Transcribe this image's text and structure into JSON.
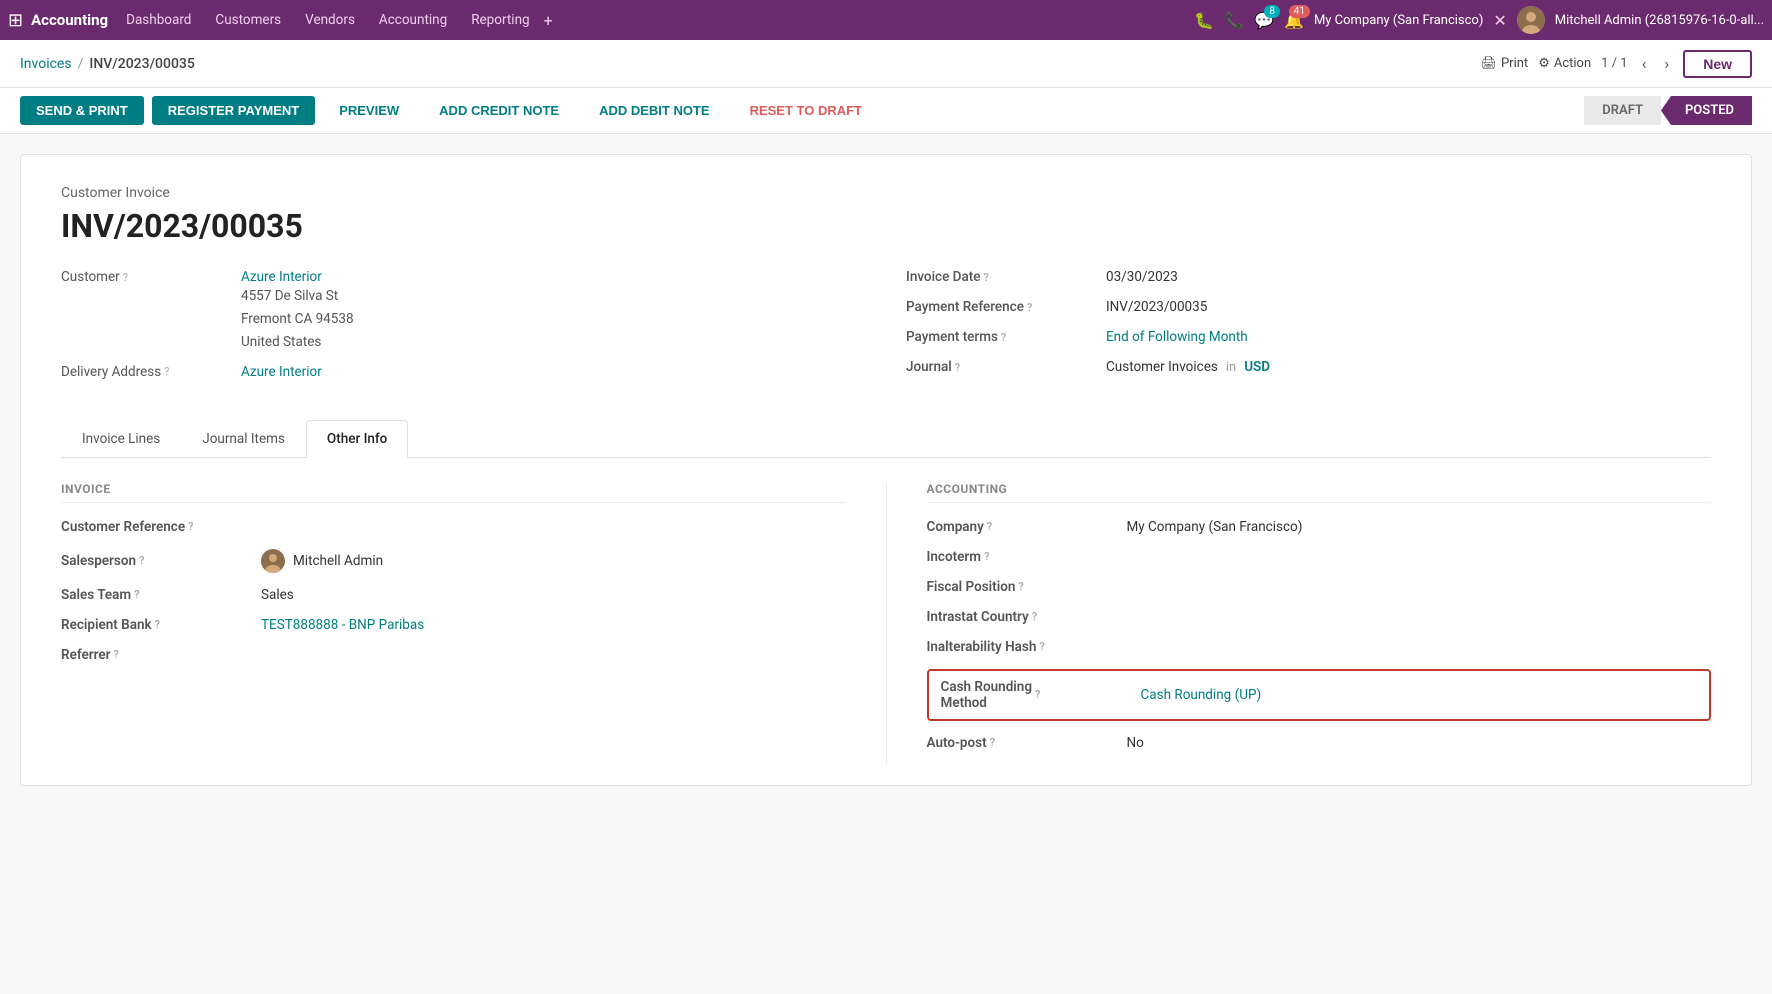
{
  "topnav": {
    "app_icon": "⊞",
    "brand": "Accounting",
    "links": [
      "Dashboard",
      "Customers",
      "Vendors",
      "Accounting",
      "Reporting"
    ],
    "plus": "+",
    "icons": [
      "bug",
      "phone",
      "chat",
      "bell"
    ],
    "chat_badge": "8",
    "bell_badge": "41",
    "company": "My Company (San Francisco)",
    "settings_icon": "⚙",
    "user": "Mitchell Admin (26815976-16-0-all..."
  },
  "breadcrumb": {
    "parent": "Invoices",
    "separator": "/",
    "current": "INV/2023/00035"
  },
  "toolbar": {
    "print_label": "Print",
    "action_label": "Action",
    "pagination": "1 / 1",
    "new_label": "New"
  },
  "actions": {
    "send_print": "SEND & PRINT",
    "register_payment": "REGISTER PAYMENT",
    "preview": "PREVIEW",
    "add_credit_note": "ADD CREDIT NOTE",
    "add_debit_note": "ADD DEBIT NOTE",
    "reset_to_draft": "RESET TO DRAFT"
  },
  "status": {
    "draft": "DRAFT",
    "posted": "POSTED"
  },
  "invoice": {
    "type": "Customer Invoice",
    "number": "INV/2023/00035",
    "customer_label": "Customer",
    "customer_name": "Azure Interior",
    "customer_address": "4557 De Silva St\nFremont CA 94538\nUnited States",
    "delivery_label": "Delivery Address",
    "delivery_value": "Azure Interior",
    "invoice_date_label": "Invoice Date",
    "invoice_date_value": "03/30/2023",
    "payment_ref_label": "Payment Reference",
    "payment_ref_value": "INV/2023/00035",
    "payment_terms_label": "Payment terms",
    "payment_terms_value": "End of Following Month",
    "journal_label": "Journal",
    "journal_value": "Customer Invoices",
    "journal_currency_prefix": "in",
    "journal_currency": "USD"
  },
  "tabs": {
    "invoice_lines": "Invoice Lines",
    "journal_items": "Journal Items",
    "other_info": "Other Info"
  },
  "other_info": {
    "invoice_section_title": "INVOICE",
    "accounting_section_title": "ACCOUNTING",
    "customer_reference_label": "Customer Reference",
    "salesperson_label": "Salesperson",
    "salesperson_value": "Mitchell Admin",
    "sales_team_label": "Sales Team",
    "sales_team_value": "Sales",
    "recipient_bank_label": "Recipient Bank",
    "recipient_bank_value": "TEST888888 - BNP Paribas",
    "referrer_label": "Referrer",
    "company_label": "Company",
    "company_value": "My Company (San Francisco)",
    "incoterm_label": "Incoterm",
    "fiscal_position_label": "Fiscal Position",
    "intrastat_country_label": "Intrastat Country",
    "inalterability_hash_label": "Inalterability Hash",
    "cash_rounding_label": "Cash Rounding\nMethod",
    "cash_rounding_value": "Cash Rounding (UP)",
    "auto_post_label": "Auto-post",
    "auto_post_value": "No"
  }
}
